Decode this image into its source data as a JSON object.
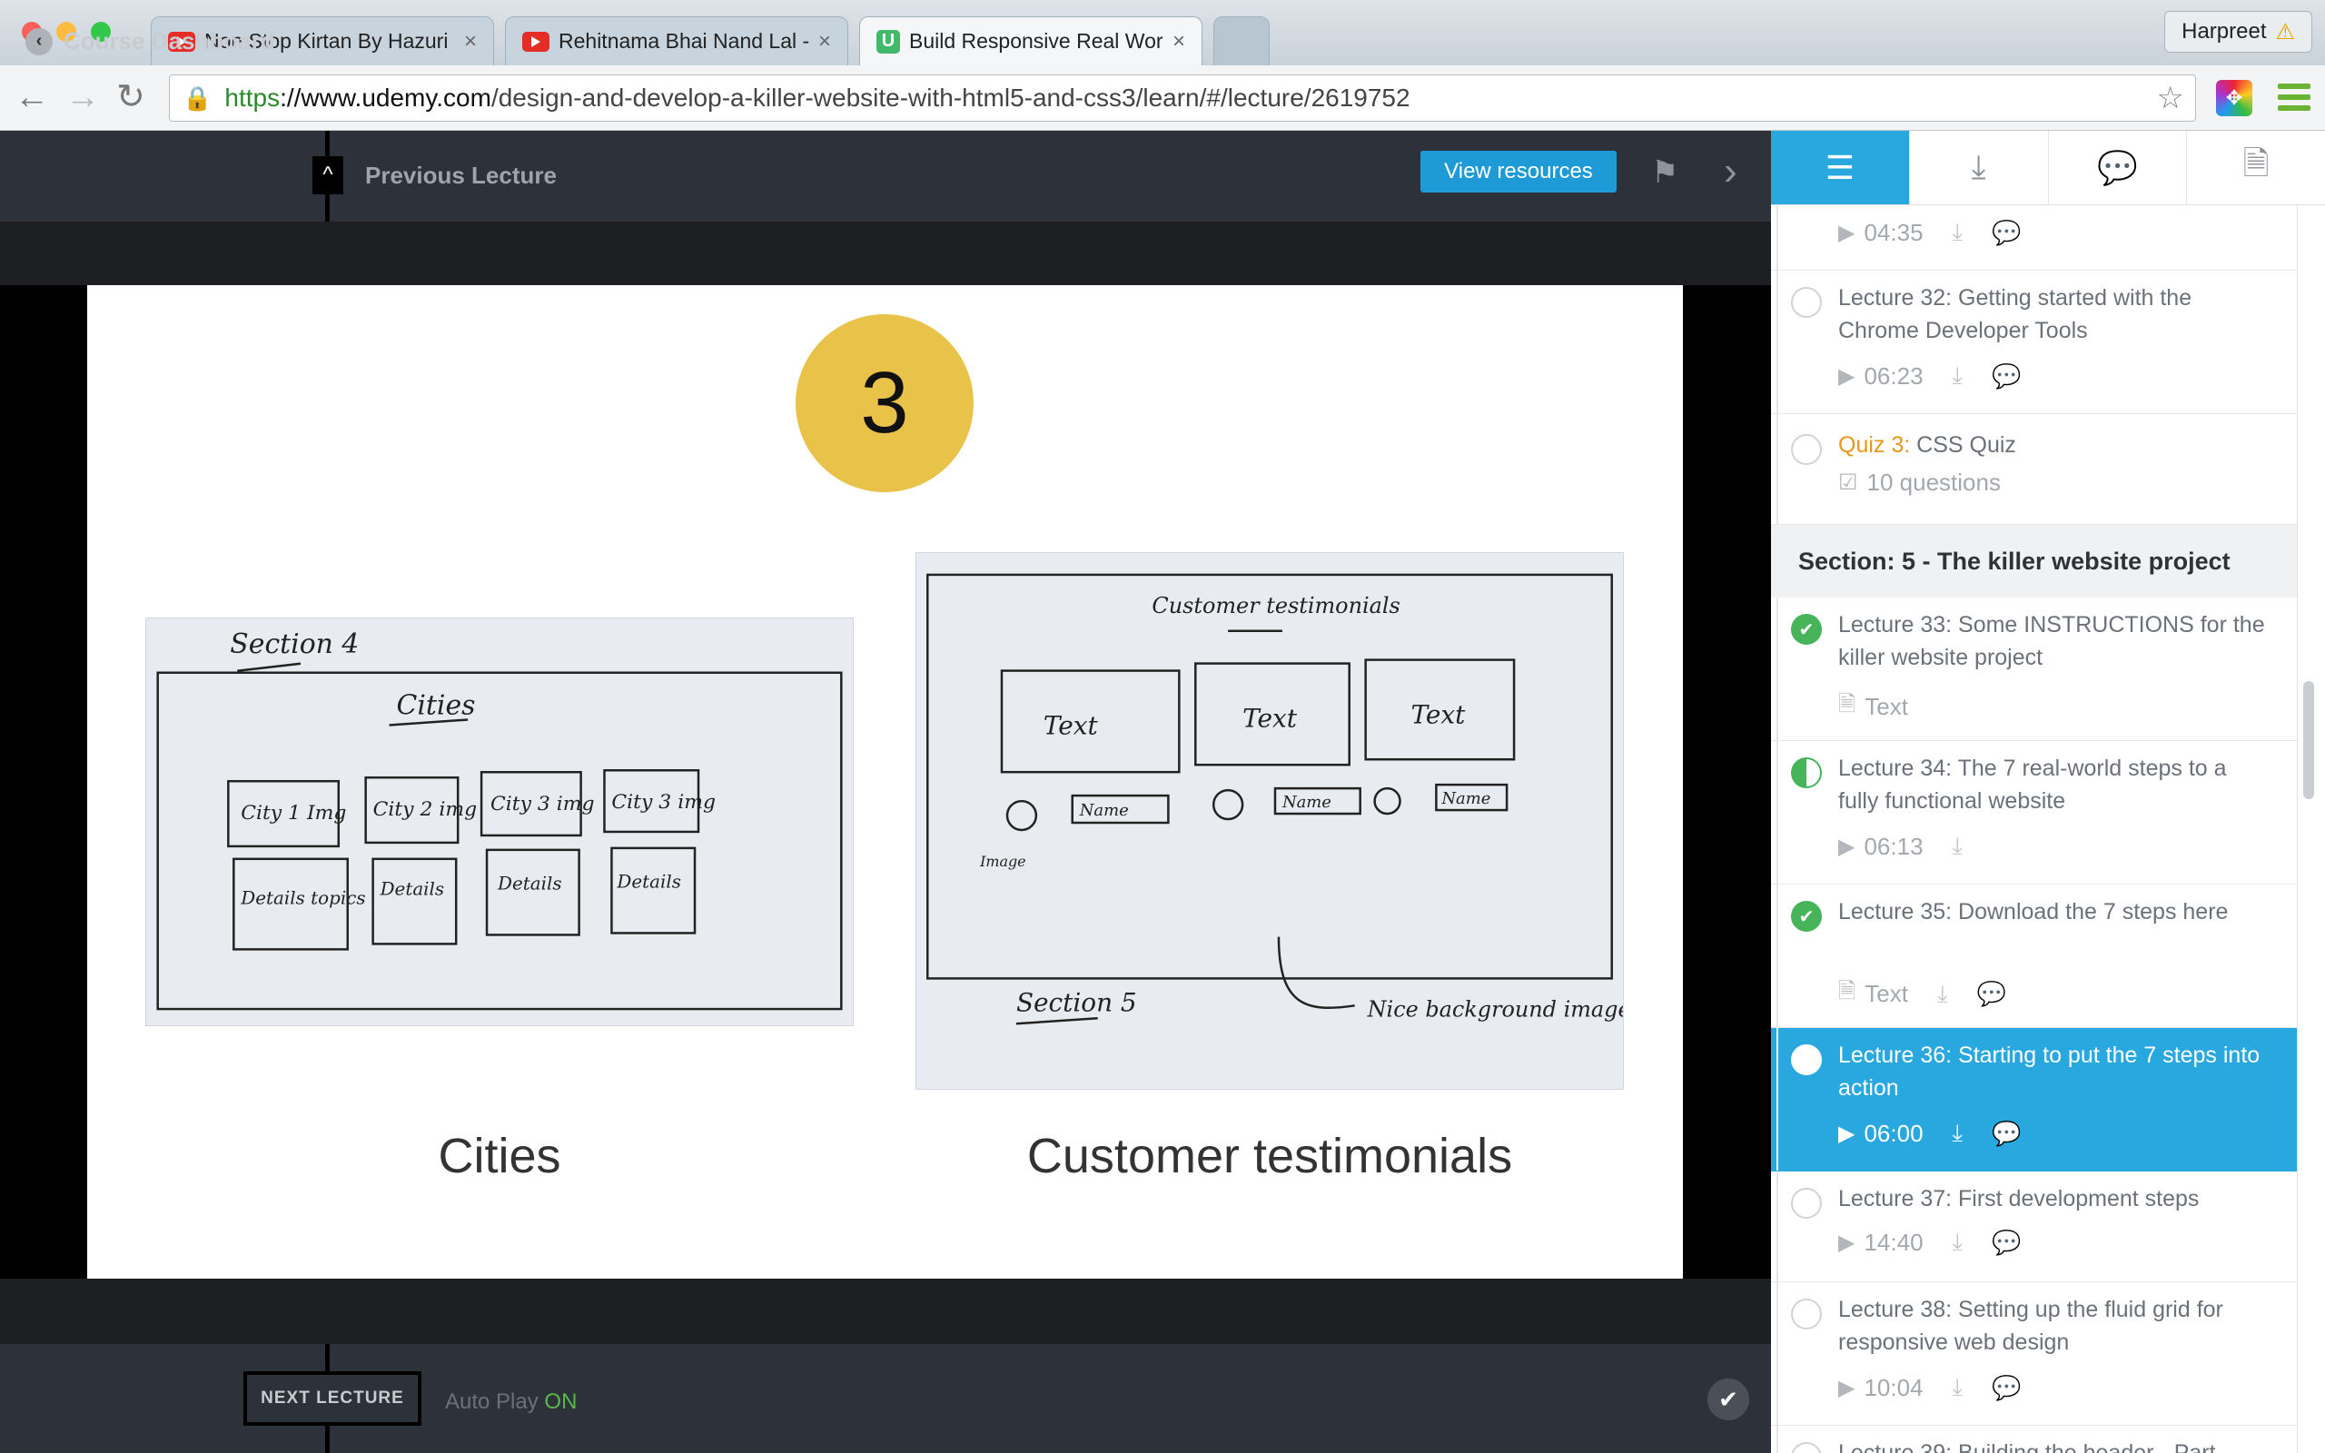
{
  "browser": {
    "tabs": [
      {
        "title": "Non Stop Kirtan By Hazuri"
      },
      {
        "title": "Rehitnama Bhai Nand Lal -"
      },
      {
        "title": "Build Responsive Real Wor"
      }
    ],
    "profile": "Harpreet",
    "url": {
      "scheme": "https",
      "host": "://www.udemy.com",
      "path": "/design-and-develop-a-killer-website-with-html5-and-css3/learn/#/lecture/2619752"
    }
  },
  "player": {
    "course_dashboard": "Course Dashboard",
    "previous_lecture": "Previous Lecture",
    "view_resources": "View resources",
    "next_lecture": "NEXT LECTURE",
    "autoplay_label": "Auto Play",
    "autoplay_state": "ON"
  },
  "slide": {
    "badge": "3",
    "left_caption": "Cities",
    "right_caption": "Customer testimonials",
    "left_sketch": {
      "heading": "Section 4",
      "title": "Cities",
      "cities": [
        "City 1 Img",
        "City 2 img",
        "City 3 img",
        "City 3 img"
      ],
      "details": [
        "Details topics",
        "Details",
        "Details",
        "Details"
      ]
    },
    "right_sketch": {
      "title": "Customer testimonials",
      "texts": [
        "Text",
        "Text",
        "Text"
      ],
      "names": [
        "Name",
        "Name",
        "Name"
      ],
      "image_note": "Image",
      "section": "Section 5",
      "note": "Nice background image"
    }
  },
  "sidebar": {
    "tabs": [
      "curriculum-icon",
      "download-icon",
      "chat-icon",
      "notes-icon"
    ],
    "items": [
      {
        "title": "",
        "meta": "04:35",
        "type": "video",
        "state": "empty",
        "downloads": true,
        "comments": true
      },
      {
        "title": "Lecture 32: Getting started with the Chrome Developer Tools",
        "meta": "06:23",
        "type": "video",
        "state": "empty",
        "downloads": true,
        "comments": true
      },
      {
        "prefix": "Quiz 3:",
        "title": "CSS Quiz",
        "meta": "10 questions",
        "type": "quiz",
        "state": "empty"
      },
      {
        "section": "Section: 5 - The killer website project"
      },
      {
        "title": "Lecture 33: Some INSTRUCTIONS for the killer website project",
        "meta": "Text",
        "type": "text",
        "state": "done"
      },
      {
        "title": "Lecture 34: The 7 real-world steps to a fully functional website",
        "meta": "06:13",
        "type": "video",
        "state": "half",
        "downloads": true
      },
      {
        "title": "Lecture 35: Download the 7 steps here",
        "meta": "Text",
        "type": "text",
        "state": "done",
        "downloads": true,
        "comments": true
      },
      {
        "title": "Lecture 36: Starting to put the 7 steps into action",
        "meta": "06:00",
        "type": "video",
        "state": "current",
        "downloads": true,
        "comments": true
      },
      {
        "title": "Lecture 37: First development steps",
        "meta": "14:40",
        "type": "video",
        "state": "empty",
        "downloads": true,
        "comments": true
      },
      {
        "title": "Lecture 38: Setting up the fluid grid for responsive web design",
        "meta": "10:04",
        "type": "video",
        "state": "empty",
        "downloads": true,
        "comments": true
      },
      {
        "title": "Lecture 39: Building the header - Part",
        "type": "partial"
      }
    ]
  },
  "colors": {
    "accent": "#29a8e0",
    "complete": "#47b45a",
    "quiz": "#e8971b",
    "badge": "#e9c24a"
  }
}
